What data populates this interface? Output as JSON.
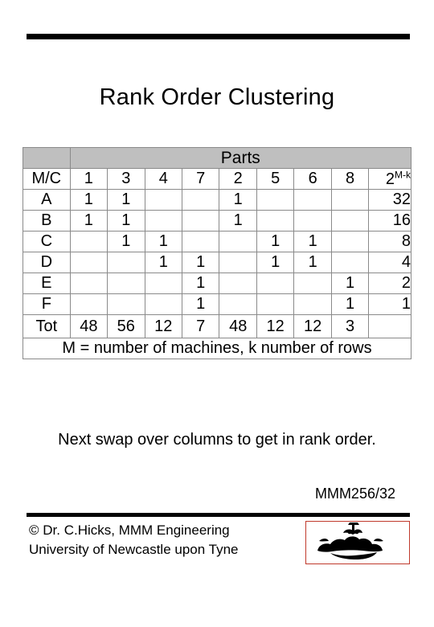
{
  "slide": {
    "title": "Rank Order Clustering",
    "next_step_text": "Next swap over columns to get in rank order.",
    "code": "MMM256/32",
    "footer_line1": "© Dr. C.Hicks, MMM Engineering",
    "footer_line2": "University of Newcastle upon Tyne",
    "crest_label": "newcastle-crest"
  },
  "matrix": {
    "parts_header": "Parts",
    "row_label_header": "M/C",
    "exp_header_base": "2",
    "exp_header_sup": "M-k",
    "part_columns": [
      "1",
      "3",
      "4",
      "7",
      "2",
      "5",
      "6",
      "8"
    ],
    "rows": [
      {
        "label": "A",
        "cells": [
          "1",
          "1",
          "",
          "",
          "1",
          "",
          "",
          ""
        ],
        "weight": "32"
      },
      {
        "label": "B",
        "cells": [
          "1",
          "1",
          "",
          "",
          "1",
          "",
          "",
          ""
        ],
        "weight": "16"
      },
      {
        "label": "C",
        "cells": [
          "",
          "1",
          "1",
          "",
          "",
          "1",
          "1",
          ""
        ],
        "weight": "8"
      },
      {
        "label": "D",
        "cells": [
          "",
          "",
          "1",
          "1",
          "",
          "1",
          "1",
          ""
        ],
        "weight": "4"
      },
      {
        "label": "E",
        "cells": [
          "",
          "",
          "",
          "1",
          "",
          "",
          "",
          "1"
        ],
        "weight": "2"
      },
      {
        "label": "F",
        "cells": [
          "",
          "",
          "",
          "1",
          "",
          "",
          "",
          "1"
        ],
        "weight": "1"
      }
    ],
    "total_label": "Tot",
    "totals": [
      "48",
      "56",
      "12",
      "7",
      "48",
      "12",
      "12",
      "3"
    ],
    "total_weight": "",
    "caption": "M = number of machines, k number of rows"
  }
}
